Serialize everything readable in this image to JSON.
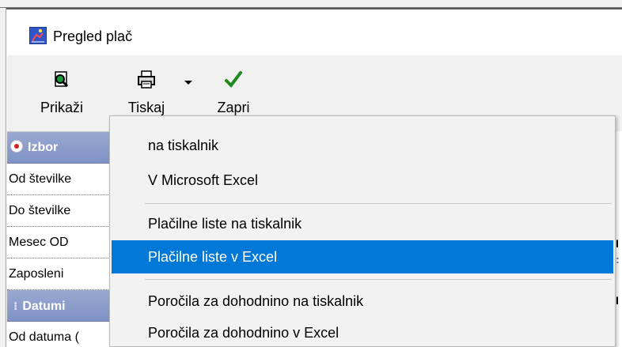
{
  "window": {
    "title": "Pregled plač"
  },
  "toolbar": {
    "buttons": [
      {
        "label": "Prikaži",
        "icon": "magnifier-page-icon"
      },
      {
        "label": "Tiskaj",
        "icon": "printer-icon"
      },
      {
        "label": "Zapri",
        "icon": "checkmark-icon"
      }
    ]
  },
  "grid": {
    "rows": [
      {
        "label": "Izbor",
        "kind": "header"
      },
      {
        "label": "Od številke"
      },
      {
        "label": "Do številke"
      },
      {
        "label": "Mesec OD"
      },
      {
        "label": "Zaposleni"
      },
      {
        "label": "Datumi",
        "kind": "header"
      },
      {
        "label": "Od datuma ("
      }
    ]
  },
  "menu": {
    "items": [
      {
        "label": "na tiskalnik"
      },
      {
        "label": "V Microsoft Excel"
      },
      {
        "label": "Plačilne liste na tiskalnik"
      },
      {
        "label": "Plačilne liste v Excel",
        "selected": true
      },
      {
        "label": "Poročila za dohodnino na tiskalnik"
      },
      {
        "label": "Poročila za dohodnino v Excel"
      }
    ]
  },
  "colors": {
    "selection": "#0078d7",
    "header_band": "#8c9dcb",
    "check_green": "#1f8a1f"
  }
}
